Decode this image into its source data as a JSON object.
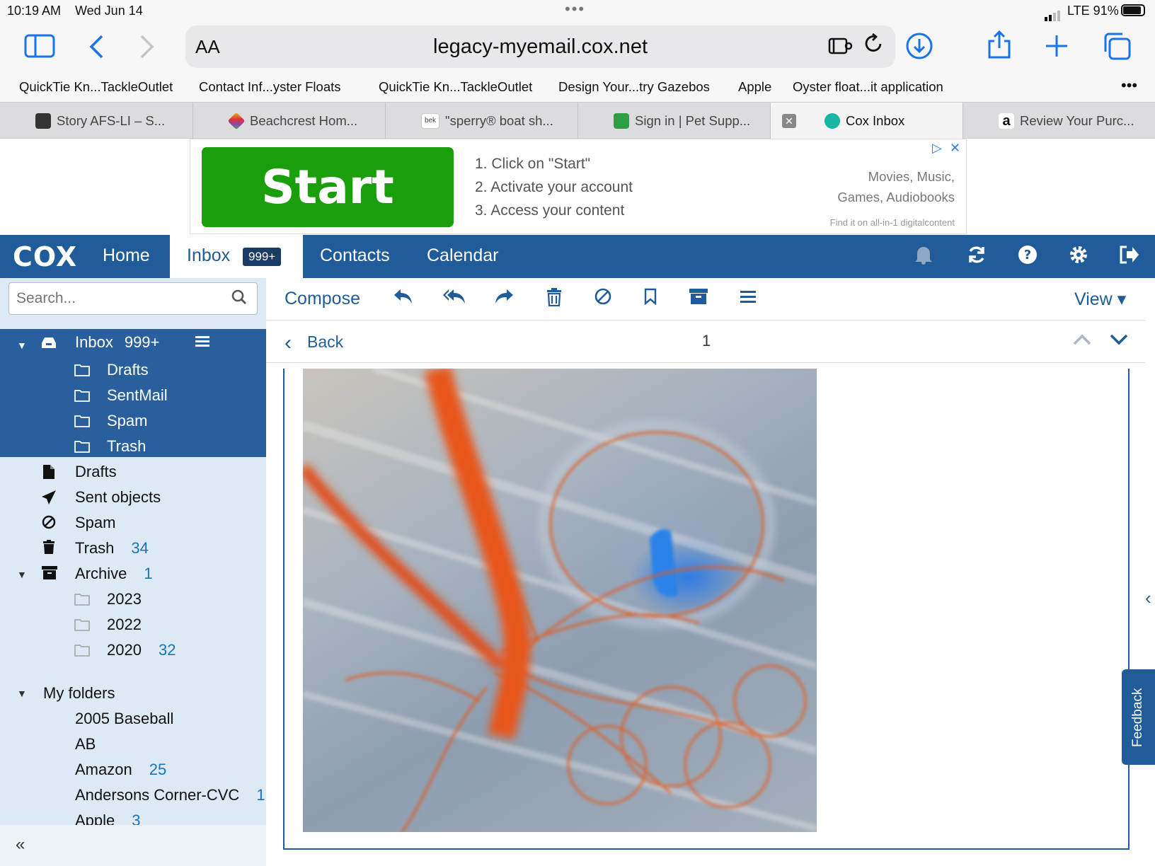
{
  "status_bar": {
    "time": "10:19 AM",
    "date": "Wed Jun 14",
    "network": "LTE 91%",
    "battery_level": 0.91
  },
  "browser": {
    "text_size_label": "AA",
    "url": "legacy-myemail.cox.net",
    "icons": [
      "sidebar-icon",
      "back-icon",
      "forward-icon",
      "extension-icon",
      "reload-icon",
      "download-icon",
      "share-icon",
      "new-tab-icon",
      "tabs-icon"
    ]
  },
  "bookmarks": [
    "QuickTie Kn...TackleOutlet",
    "Contact Inf...yster Floats",
    "QuickTie Kn...TackleOutlet",
    "Design Your...try Gazebos",
    "Apple",
    "Oyster float...it application"
  ],
  "bookmarks_more": "•••",
  "tabs": [
    {
      "label": "Story AFS-LI – S...",
      "color": "#333333"
    },
    {
      "label": "Beachcrest Hom...",
      "color": "#8e44ad"
    },
    {
      "label": "\"sperry® boat sh...",
      "color": "#555555"
    },
    {
      "label": "Sign in | Pet Supp...",
      "color": "#2e9e44"
    },
    {
      "label": "Cox Inbox",
      "color": "#19b5a5"
    },
    {
      "label": "Review Your Purc...",
      "color": "#222222"
    }
  ],
  "ad": {
    "button": "Start",
    "steps": [
      "1. Click on \"Start\"",
      "2. Activate your account",
      "3. Access your content"
    ],
    "right_line1": "Movies, Music,",
    "right_line2": "Games, Audiobooks",
    "footer": "Find it on all-in-1 digitalcontent"
  },
  "navbar": {
    "logo": "COX",
    "home": "Home",
    "inbox": "Inbox",
    "inbox_badge": "999+",
    "contacts": "Contacts",
    "calendar": "Calendar"
  },
  "search": {
    "placeholder": "Search..."
  },
  "folders": {
    "inbox": {
      "label": "Inbox",
      "count": "999+"
    },
    "inbox_children": [
      "Drafts",
      "SentMail",
      "Spam",
      "Trash"
    ],
    "drafts": "Drafts",
    "sent": "Sent objects",
    "spam": "Spam",
    "trash": {
      "label": "Trash",
      "count": "34"
    },
    "archive": {
      "label": "Archive",
      "count": "1"
    },
    "archive_children": [
      {
        "label": "2023",
        "count": ""
      },
      {
        "label": "2022",
        "count": ""
      },
      {
        "label": "2020",
        "count": "32"
      }
    ],
    "my_folders": "My folders",
    "my_folders_children": [
      {
        "label": "2005 Baseball",
        "count": ""
      },
      {
        "label": "AB",
        "count": ""
      },
      {
        "label": "Amazon",
        "count": "25"
      },
      {
        "label": "Andersons Corner-CVC",
        "count": "1"
      },
      {
        "label": "Apple",
        "count": "3"
      }
    ]
  },
  "collapse_label": "«",
  "toolbar": {
    "compose": "Compose",
    "view": "View ▾"
  },
  "message_nav": {
    "back": "Back",
    "page": "1"
  },
  "feedback": "Feedback",
  "colors": {
    "brand_blue": "#1f5c99",
    "sidebar_bg": "#dde9f4",
    "ad_green": "#1a9e0c"
  }
}
